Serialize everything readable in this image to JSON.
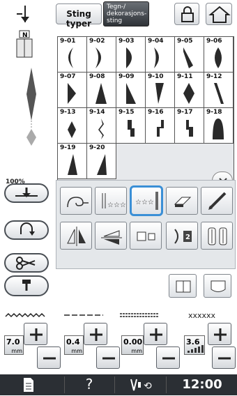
{
  "header": {
    "tab_stitch_types": "Sting typer",
    "tab_char_deco": "Tegn-/ dekorasjons- sting",
    "zoom": "100%"
  },
  "stitches": [
    {
      "code": "9-01",
      "shape": "crescent-left"
    },
    {
      "code": "9-02",
      "shape": "crescent-right"
    },
    {
      "code": "9-03",
      "shape": "half-round"
    },
    {
      "code": "9-04",
      "shape": "crescent-right-thin"
    },
    {
      "code": "9-05",
      "shape": "leaf-slant"
    },
    {
      "code": "9-06",
      "shape": "lens"
    },
    {
      "code": "9-07",
      "shape": "triangle-right"
    },
    {
      "code": "9-08",
      "shape": "triangle-up"
    },
    {
      "code": "9-09",
      "shape": "triangle-left"
    },
    {
      "code": "9-10",
      "shape": "tall-triangle"
    },
    {
      "code": "9-11",
      "shape": "diamond"
    },
    {
      "code": "9-12",
      "shape": "slant-bar"
    },
    {
      "code": "9-13",
      "shape": "diamond-small"
    },
    {
      "code": "9-14",
      "shape": "zigzag"
    },
    {
      "code": "9-15",
      "shape": "steps"
    },
    {
      "code": "9-16",
      "shape": "steps-2"
    },
    {
      "code": "9-17",
      "shape": "steps-3"
    },
    {
      "code": "9-18",
      "shape": "dome"
    },
    {
      "code": "9-19",
      "shape": "triangle-up-2"
    },
    {
      "code": "9-20",
      "shape": "triangle-up-3"
    }
  ],
  "settings": {
    "width": {
      "value": "7.0",
      "unit": "mm"
    },
    "length": {
      "value": "0.4",
      "unit": "mm"
    },
    "l_r_shift": {
      "value": "0.00",
      "unit": "mm"
    },
    "tension": {
      "value": "3.6"
    }
  },
  "footer": {
    "help": "?",
    "time": "12:00"
  },
  "colors": {
    "selected_outline": "#3a8fd6",
    "footer_bg": "#2b2f34"
  }
}
